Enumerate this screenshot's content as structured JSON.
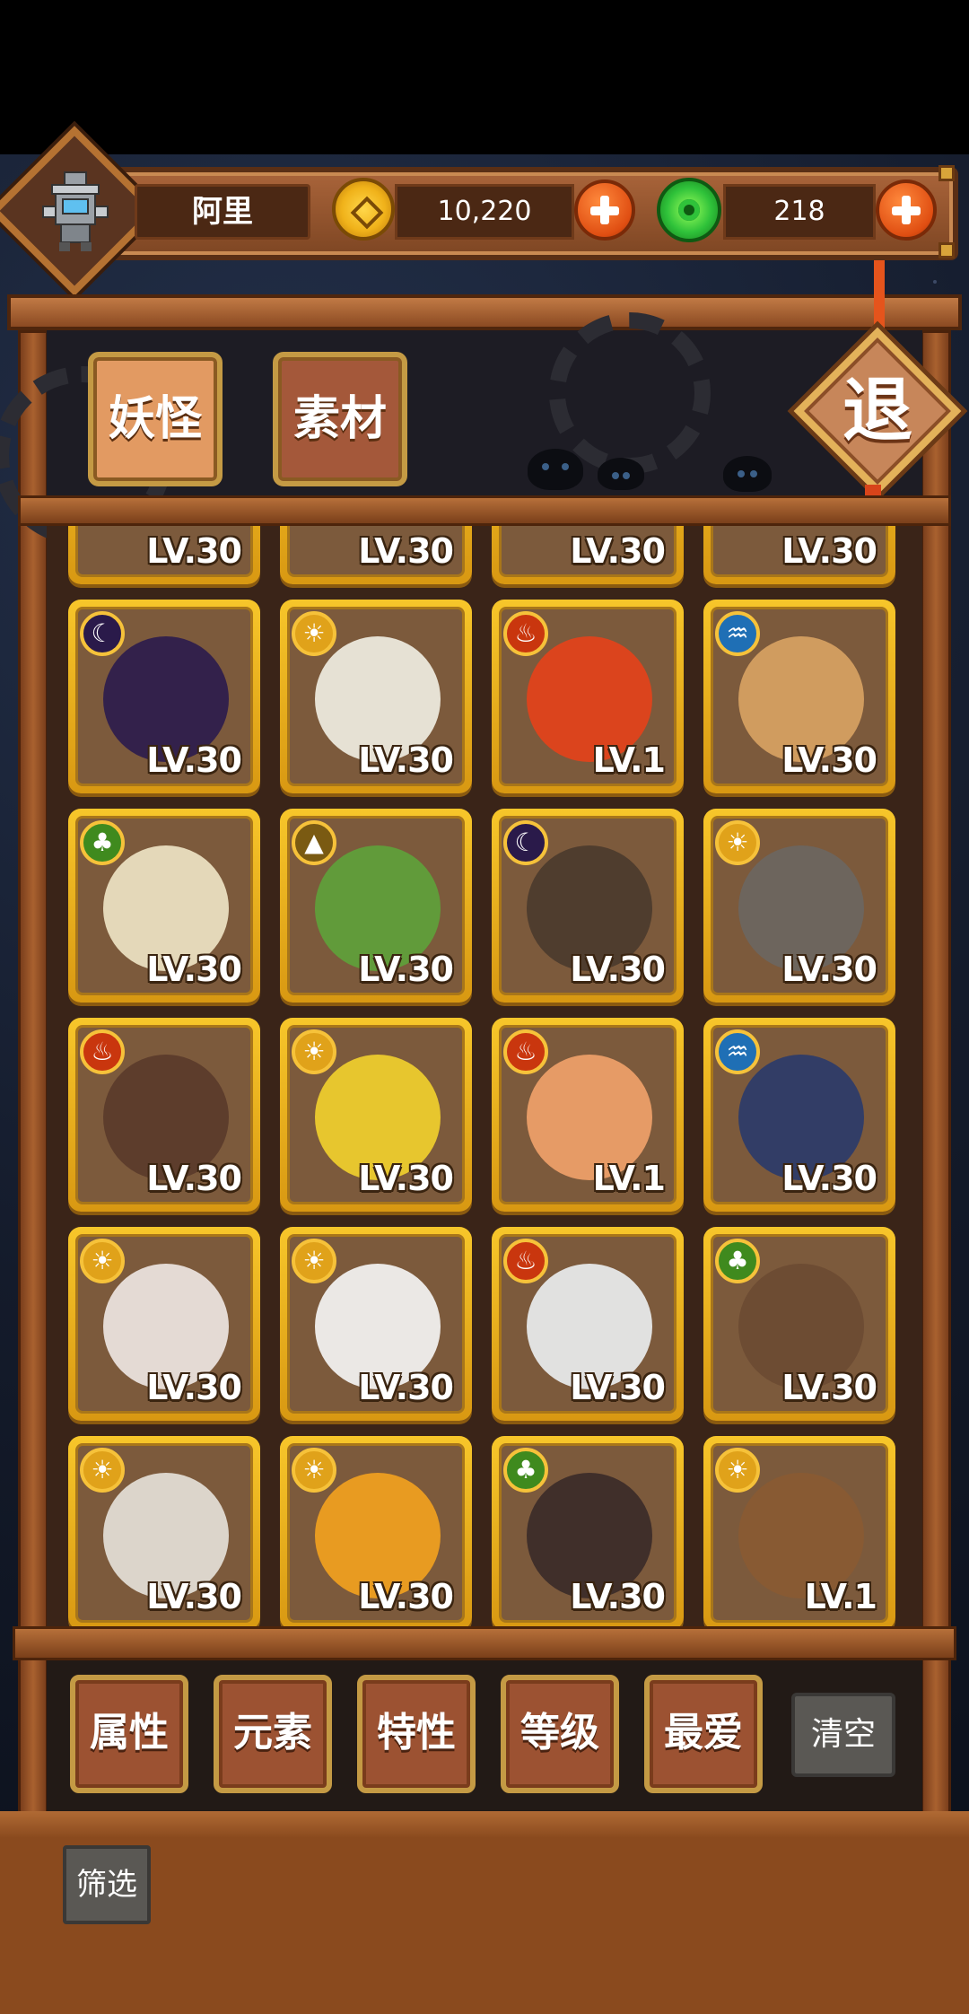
{
  "player": {
    "name": "阿里"
  },
  "currency": {
    "coins": "10,220",
    "gems": "218"
  },
  "exit_label": "退",
  "tabs": [
    {
      "label": "妖怪",
      "active": true
    },
    {
      "label": "素材",
      "active": false
    }
  ],
  "partial_row_labels": [
    "LV.30",
    "LV.30",
    "LV.30",
    "LV.30"
  ],
  "characters": [
    {
      "element": "moon",
      "color": "#2b1b4d",
      "level": "LV.30"
    },
    {
      "element": "sun",
      "color": "#f2efe4",
      "level": "LV.30"
    },
    {
      "element": "fire",
      "color": "#e5411a",
      "level": "LV.1"
    },
    {
      "element": "water",
      "color": "#d9a363",
      "level": "LV.30"
    },
    {
      "element": "leaf",
      "color": "#f0e6c6",
      "level": "LV.30"
    },
    {
      "element": "earth",
      "color": "#5ea23a",
      "level": "LV.30"
    },
    {
      "element": "moon",
      "color": "#4a3a2c",
      "level": "LV.30"
    },
    {
      "element": "sun",
      "color": "#6b6660",
      "level": "LV.30"
    },
    {
      "element": "fire",
      "color": "#5a3a2a",
      "level": "LV.30"
    },
    {
      "element": "sun",
      "color": "#f3d22c",
      "level": "LV.30"
    },
    {
      "element": "fire",
      "color": "#f2a26a",
      "level": "LV.1"
    },
    {
      "element": "water",
      "color": "#2a3a6a",
      "level": "LV.30"
    },
    {
      "element": "sun",
      "color": "#efe8e4",
      "level": "LV.30"
    },
    {
      "element": "sun",
      "color": "#f7f7f7",
      "level": "LV.30"
    },
    {
      "element": "fire",
      "color": "#eceff2",
      "level": "LV.30"
    },
    {
      "element": "leaf",
      "color": "#6b4a32",
      "level": "LV.30"
    },
    {
      "element": "sun",
      "color": "#e7e2da",
      "level": "LV.30"
    },
    {
      "element": "sun",
      "color": "#f4a21e",
      "level": "LV.30"
    },
    {
      "element": "leaf",
      "color": "#3a2a28",
      "level": "LV.30"
    },
    {
      "element": "sun",
      "color": "#8a5a32",
      "level": "LV.1"
    }
  ],
  "filters": [
    "属性",
    "元素",
    "特性",
    "等级",
    "最爱"
  ],
  "clear_label": "清空",
  "filter_label": "筛选"
}
